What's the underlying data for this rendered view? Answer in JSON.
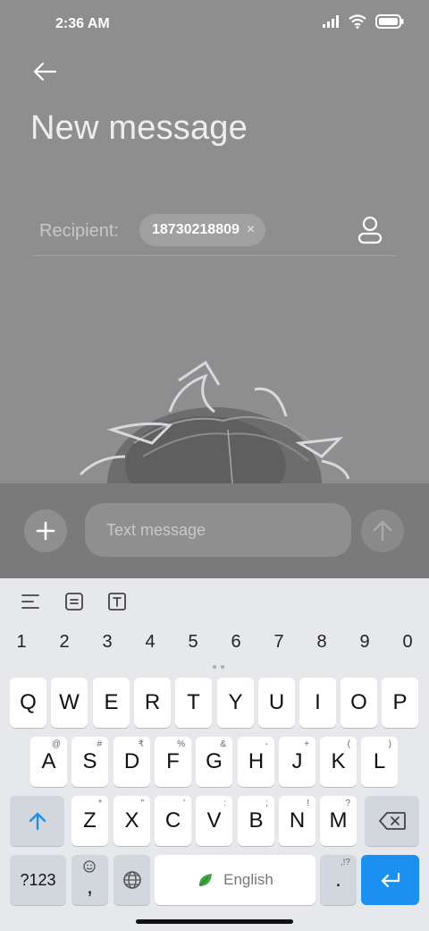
{
  "status_bar": {
    "time": "2:36 AM"
  },
  "header": {
    "title": "New message"
  },
  "recipient": {
    "label": "Recipient:",
    "chip_number": "18730218809",
    "chip_remove_glyph": "×"
  },
  "compose": {
    "placeholder": "Text message"
  },
  "keyboard": {
    "numbers": [
      "1",
      "2",
      "3",
      "4",
      "5",
      "6",
      "7",
      "8",
      "9",
      "0"
    ],
    "row1": [
      "Q",
      "W",
      "E",
      "R",
      "T",
      "Y",
      "U",
      "I",
      "O",
      "P"
    ],
    "row2": [
      {
        "key": "A",
        "hint": "@"
      },
      {
        "key": "S",
        "hint": "#"
      },
      {
        "key": "D",
        "hint": "₹"
      },
      {
        "key": "F",
        "hint": "%"
      },
      {
        "key": "G",
        "hint": "&"
      },
      {
        "key": "H",
        "hint": "-"
      },
      {
        "key": "J",
        "hint": "+"
      },
      {
        "key": "K",
        "hint": "("
      },
      {
        "key": "L",
        "hint": ")"
      }
    ],
    "row3": [
      {
        "key": "Z",
        "hint": "*"
      },
      {
        "key": "X",
        "hint": "\""
      },
      {
        "key": "C",
        "hint": "'"
      },
      {
        "key": "V",
        "hint": ":"
      },
      {
        "key": "B",
        "hint": ";"
      },
      {
        "key": "N",
        "hint": "!"
      },
      {
        "key": "M",
        "hint": "?"
      }
    ],
    "symbols_label": "?123",
    "comma_label": ",",
    "space_label": "English",
    "period_label": ".",
    "period_hint": ",!?"
  },
  "colors": {
    "accent": "#1a91f2",
    "overlay": "#8e8e8e",
    "keyboard_bg": "#e6e8ec"
  },
  "icons": [
    "signal-icon",
    "wifi-icon",
    "battery-icon",
    "back-arrow-icon",
    "contacts-icon",
    "plus-icon",
    "send-arrow-icon",
    "align-icon",
    "clipboard-icon",
    "text-format-icon",
    "shift-arrow-icon",
    "backspace-icon",
    "emoji-icon",
    "globe-icon",
    "leaf-icon",
    "enter-icon"
  ]
}
